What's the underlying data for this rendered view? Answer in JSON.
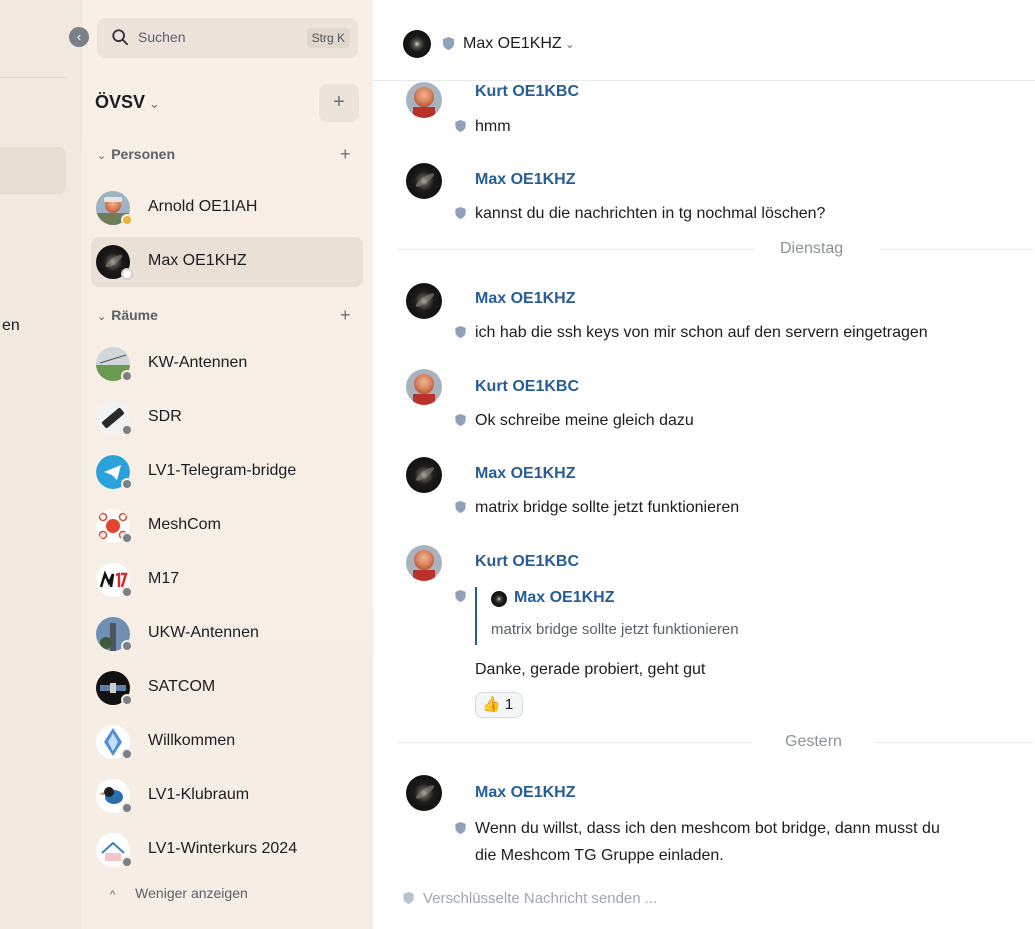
{
  "space_panel": {
    "cut_label": "en"
  },
  "search": {
    "placeholder": "Suchen",
    "shortcut": "Strg K"
  },
  "space": {
    "name": "ÖVSV",
    "chevron": "⌄",
    "add_symbol": "+"
  },
  "sections": {
    "people": {
      "title": "Personen",
      "arrow": "⌄",
      "plus": "+"
    },
    "rooms": {
      "title": "Räume",
      "arrow": "⌄",
      "plus": "+"
    }
  },
  "people": [
    {
      "name": "Arnold OE1IAH",
      "badge": "yellow"
    },
    {
      "name": "Max OE1KHZ",
      "badge": "white",
      "active": true
    }
  ],
  "rooms": [
    {
      "name": "KW-Antennen"
    },
    {
      "name": "SDR"
    },
    {
      "name": "LV1-Telegram-bridge"
    },
    {
      "name": "MeshCom"
    },
    {
      "name": "M17"
    },
    {
      "name": "UKW-Antennen"
    },
    {
      "name": "SATCOM"
    },
    {
      "name": "Willkommen"
    },
    {
      "name": "LV1-Klubraum"
    },
    {
      "name": "LV1-Winterkurs 2024"
    }
  ],
  "show_less": {
    "arrow": "^",
    "label": "Weniger anzeigen"
  },
  "header": {
    "name": "Max OE1KHZ",
    "chevron": "⌄"
  },
  "messages": [
    {
      "sender": "Kurt OE1KBC",
      "text": "hmm"
    },
    {
      "sender": "Max OE1KHZ",
      "text": "kannst du die nachrichten in tg nochmal löschen?"
    },
    {
      "sender": "Max OE1KHZ",
      "text": "ich hab die ssh keys von mir schon auf den servern eingetragen"
    },
    {
      "sender": "Kurt OE1KBC",
      "text": "Ok schreibe meine gleich dazu"
    },
    {
      "sender": "Max OE1KHZ",
      "text": "matrix bridge sollte jetzt funktionieren"
    },
    {
      "sender": "Kurt OE1KBC",
      "text": "Danke, gerade probiert, geht gut"
    },
    {
      "sender": "Max OE1KHZ",
      "text": "Wenn du willst, dass ich den meshcom bot bridge, dann musst du",
      "text2": "die Meshcom TG Gruppe einladen."
    }
  ],
  "dates": [
    "Dienstag",
    "Gestern"
  ],
  "quote": {
    "name": "Max OE1KHZ",
    "text": "matrix bridge sollte jetzt funktionieren"
  },
  "reaction": {
    "emoji": "👍",
    "count": "1"
  },
  "composer": {
    "placeholder": "Verschlüsselte Nachricht senden ..."
  },
  "colors": {
    "accent": "#275d97",
    "sidebar": "#f6ede4",
    "muted": "#8d9199"
  }
}
